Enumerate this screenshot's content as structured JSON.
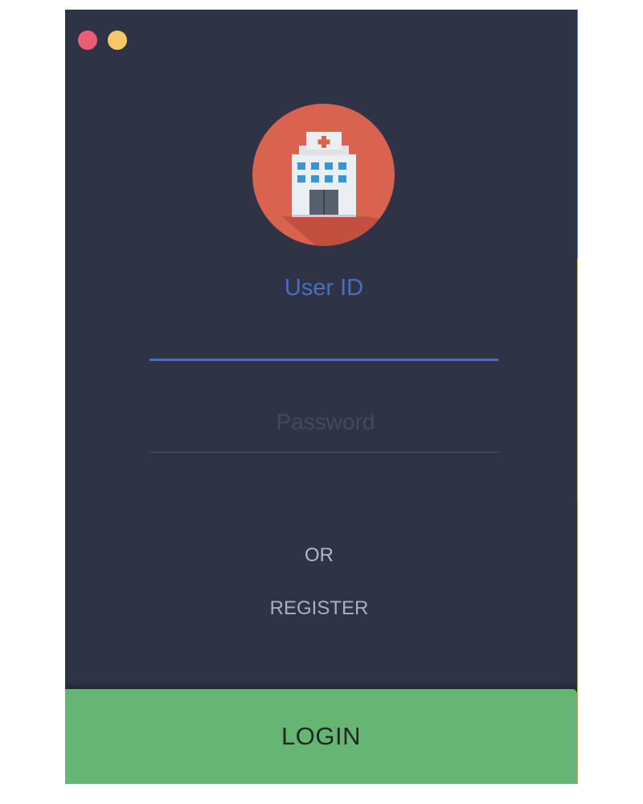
{
  "window": {
    "background": "#2e3446",
    "controls": [
      {
        "name": "close",
        "color": "#ec5d75"
      },
      {
        "name": "minimize",
        "color": "#f8c766"
      }
    ]
  },
  "logo": {
    "icon": "hospital-building-icon",
    "circle_color": "#d9634e"
  },
  "user_id": {
    "label": "User ID",
    "value": "",
    "accent": "#4a6fbf"
  },
  "password": {
    "placeholder": "Password",
    "value": ""
  },
  "alt": {
    "or_text": "OR",
    "register_label": "REGISTER"
  },
  "login": {
    "label": "LOGIN",
    "color": "#66b574"
  }
}
